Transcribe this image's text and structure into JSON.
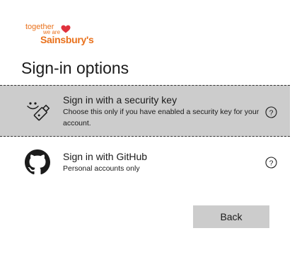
{
  "logo": {
    "together": "together",
    "we_are": "we are",
    "brand": "Sainsbury's",
    "color": "#e9711c",
    "heart_color": "#e0323d"
  },
  "title": "Sign-in options",
  "options": [
    {
      "title": "Sign in with a security key",
      "description": "Choose this only if you have enabled a security key for your account.",
      "icon": "security-key-icon",
      "selected": true,
      "background": "#cccccc"
    },
    {
      "title": "Sign in with GitHub",
      "description": "Personal accounts only",
      "icon": "github-icon",
      "selected": false
    }
  ],
  "back_label": "Back"
}
